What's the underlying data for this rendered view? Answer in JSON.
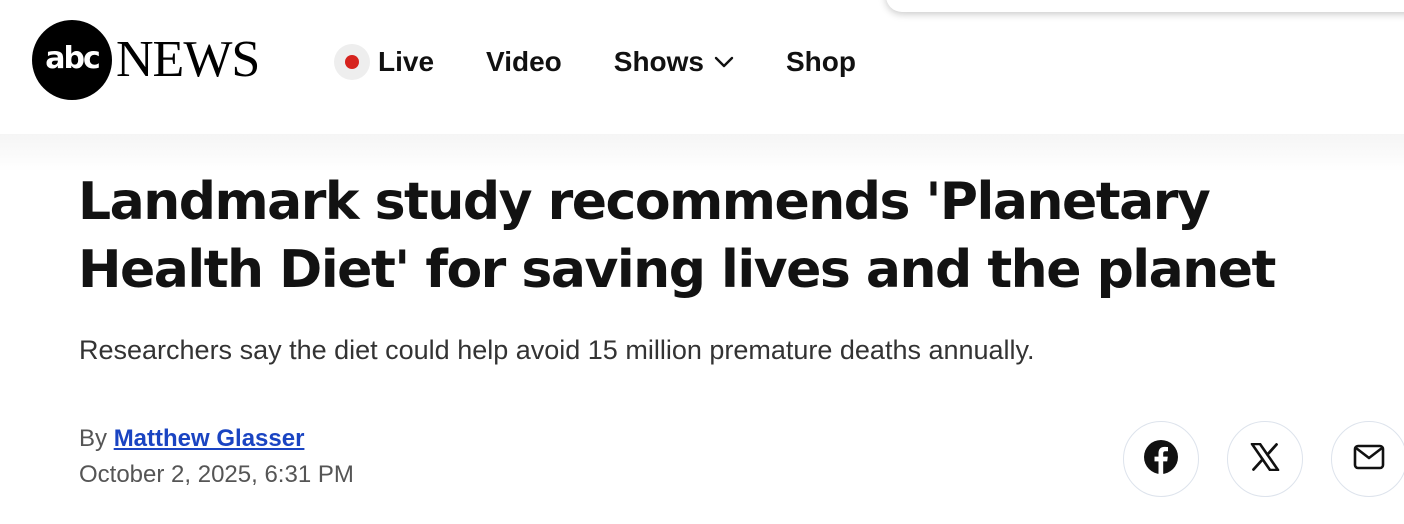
{
  "header": {
    "logo": {
      "circle_text": "abc",
      "wordmark": "NEWS"
    },
    "nav": {
      "live": "Live",
      "video": "Video",
      "shows": "Shows",
      "shop": "Shop"
    }
  },
  "article": {
    "title": "Landmark study recommends 'Planetary Health Diet' for saving lives and the planet",
    "subhead": "Researchers say the diet could help avoid 15 million premature deaths annually.",
    "byline_prefix": "By ",
    "author": "Matthew Glasser",
    "date": "October 2, 2025, 6:31 PM"
  },
  "share": {
    "icons": [
      "facebook-icon",
      "x-icon",
      "mail-icon"
    ]
  },
  "colors": {
    "live_dot": "#d6231e",
    "author_link": "#1a44c2",
    "text_dark": "#121212",
    "text_muted": "#555555"
  }
}
